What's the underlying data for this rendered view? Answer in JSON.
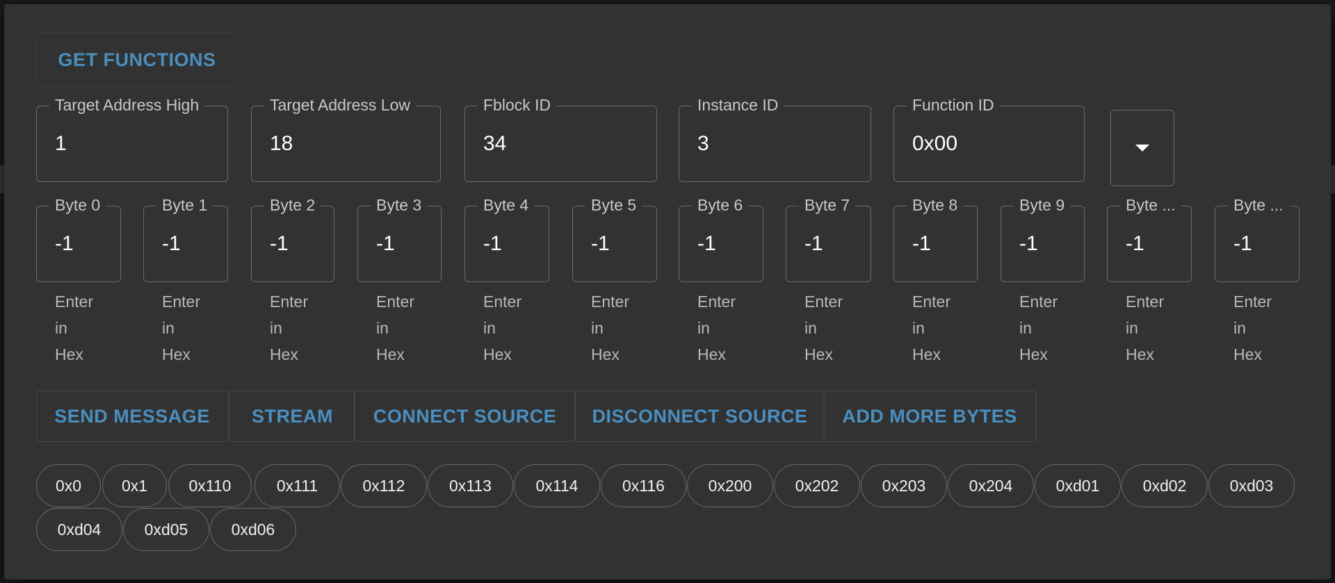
{
  "dialog": {
    "get_functions_label": "GET FUNCTIONS",
    "address_fields": [
      {
        "label": "Target Address High",
        "value": "1"
      },
      {
        "label": "Target Address Low",
        "value": "18"
      },
      {
        "label": "Fblock ID",
        "value": "34"
      },
      {
        "label": "Instance ID",
        "value": "3"
      },
      {
        "label": "Function ID",
        "value": "0x00"
      }
    ],
    "dropdown_icon": "caret-down-icon",
    "byte_fields": [
      {
        "label": "Byte 0",
        "value": "-1",
        "helper": "Enter in Hex"
      },
      {
        "label": "Byte 1",
        "value": "-1",
        "helper": "Enter in Hex"
      },
      {
        "label": "Byte 2",
        "value": "-1",
        "helper": "Enter in Hex"
      },
      {
        "label": "Byte 3",
        "value": "-1",
        "helper": "Enter in Hex"
      },
      {
        "label": "Byte 4",
        "value": "-1",
        "helper": "Enter in Hex"
      },
      {
        "label": "Byte 5",
        "value": "-1",
        "helper": "Enter in Hex"
      },
      {
        "label": "Byte 6",
        "value": "-1",
        "helper": "Enter in Hex"
      },
      {
        "label": "Byte 7",
        "value": "-1",
        "helper": "Enter in Hex"
      },
      {
        "label": "Byte 8",
        "value": "-1",
        "helper": "Enter in Hex"
      },
      {
        "label": "Byte 9",
        "value": "-1",
        "helper": "Enter in Hex"
      },
      {
        "label": "Byte ...",
        "value": "-1",
        "helper": "Enter in Hex"
      },
      {
        "label": "Byte ...",
        "value": "-1",
        "helper": "Enter in Hex"
      }
    ],
    "actions": {
      "send_message": "SEND MESSAGE",
      "stream": "STREAM",
      "connect_source": "CONNECT SOURCE",
      "disconnect_source": "DISCONNECT SOURCE",
      "add_more_bytes": "ADD MORE BYTES"
    },
    "function_chips": [
      "0x0",
      "0x1",
      "0x110",
      "0x111",
      "0x112",
      "0x113",
      "0x114",
      "0x116",
      "0x200",
      "0x202",
      "0x203",
      "0x204",
      "0xd01",
      "0xd02",
      "0xd03",
      "0xd04",
      "0xd05",
      "0xd06"
    ]
  },
  "colors": {
    "dialog_bg": "#323232",
    "accent": "#4a8fc0",
    "outline": "#6a6a6a"
  }
}
